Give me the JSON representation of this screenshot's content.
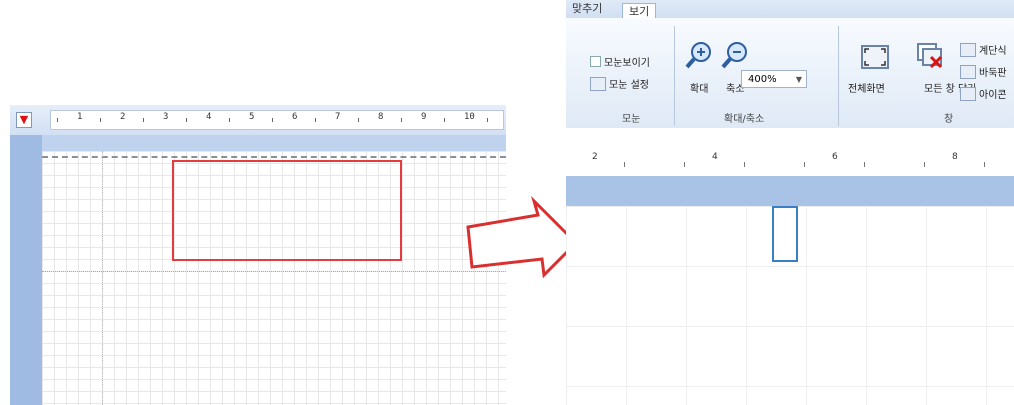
{
  "left": {
    "ruler_tab_icon": "tab-stop-icon",
    "ruler_numbers": [
      "1",
      "2",
      "3",
      "4",
      "5",
      "6",
      "7",
      "8",
      "9",
      "10"
    ]
  },
  "ribbon": {
    "tabs": [
      {
        "label": "맞추기",
        "active": false
      },
      {
        "label": "보기",
        "active": true
      }
    ],
    "show_group": {
      "show_all_label": "모눈보이기",
      "settings_label": "모눈 설정",
      "group_label": "모눈"
    },
    "zoom_group": {
      "zoom_in_label": "확대",
      "zoom_out_label": "축소",
      "zoom_value": "400%",
      "group_label": "확대/축소"
    },
    "window_group": {
      "fullscreen_label": "전체화면",
      "close_all_label": "모든 창 닫기",
      "cascade_label": "계단식",
      "tile_label": "바둑판",
      "icon_label": "아이콘",
      "group_label": "창"
    }
  },
  "right": {
    "ruler_numbers": [
      "2",
      "4",
      "6",
      "8"
    ]
  },
  "colors": {
    "highlight_red": "#e23c3c",
    "highlight_blue": "#3a7fc4",
    "arrow_red": "#d9302f"
  }
}
